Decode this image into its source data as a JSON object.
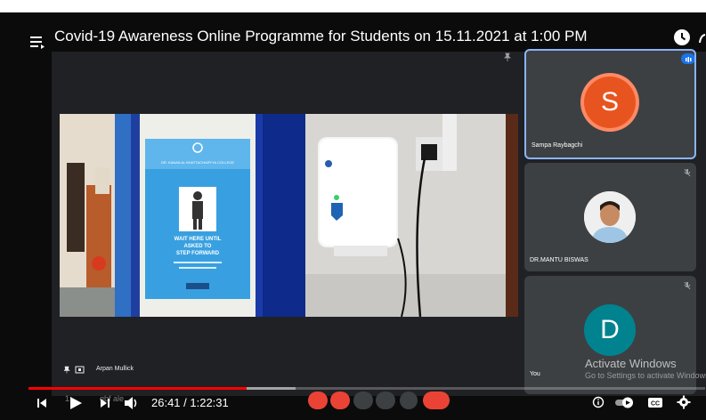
{
  "video": {
    "title": "Covid-19 Awareness Online Programme for Students on 15.11.2021 at 1:00 PM",
    "current_time": "26:41",
    "duration": "1:22:31",
    "time_display": "26:41 / 1:22:31",
    "progress": 0.323,
    "overlay_time": "1:",
    "overlay_code": "qbf   ale"
  },
  "meeting": {
    "presenter_name": "Arpan Mullick",
    "participants": [
      {
        "name": "Sampa Raybagchi",
        "initial": "S",
        "avatar_color": "#e8541f"
      },
      {
        "name": "DR.MANTU BISWAS",
        "initial": "",
        "avatar_color": "#d9d9d9"
      },
      {
        "name": "You",
        "initial": "D",
        "avatar_color": "#00838f"
      }
    ],
    "controls": [
      "mic-off",
      "camera-off",
      "captions",
      "present",
      "more",
      "end-call"
    ]
  },
  "scene": {
    "poster_text": "WAIT HERE UNTIL ASKED TO STEP FORWARD",
    "poster_header": "DR. KANAILAL BHATTACHARYYA COLLEGE"
  },
  "watermark": {
    "line1": "Activate Windows",
    "line2": "Go to Settings to activate Windows."
  },
  "colors": {
    "progress": "#ff0000",
    "end_call": "#ea4335",
    "meet_bg": "#202124",
    "tile_bg": "#3c4043",
    "active_border": "#8ab4f8"
  }
}
